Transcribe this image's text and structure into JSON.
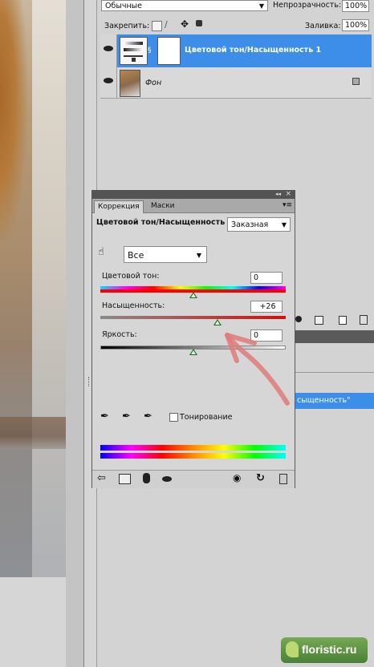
{
  "layers_panel": {
    "blend_mode": "Обычные",
    "opacity_label": "Непрозрачность:",
    "opacity_value": "100%",
    "lock_label": "Закрепить:",
    "fill_label": "Заливка:",
    "fill_value": "100%",
    "layers": [
      {
        "name": "Цветовой тон/Насыщенность 1",
        "selected": true
      },
      {
        "name": "Фон",
        "selected": false
      }
    ],
    "partial_text": "сыщенность\""
  },
  "correction_panel": {
    "tabs": [
      {
        "label": "Коррекция"
      },
      {
        "label": "Маски"
      }
    ],
    "title": "Цветовой тон/Насыщенность",
    "preset": "Заказная",
    "channel": "Все",
    "hue": {
      "label": "Цветовой тон:",
      "value": "0",
      "fraction": 0.5
    },
    "saturation": {
      "label": "Насыщенность:",
      "value": "+26",
      "fraction": 0.63
    },
    "lightness": {
      "label": "Яркость:",
      "value": "0",
      "fraction": 0.5
    },
    "colorize_label": "Тонирование",
    "colorize_checked": false
  },
  "watermark": {
    "text": "floristic.ru"
  },
  "colors": {
    "selection": "#3d8ee8",
    "annotation": "#e07a7a"
  }
}
